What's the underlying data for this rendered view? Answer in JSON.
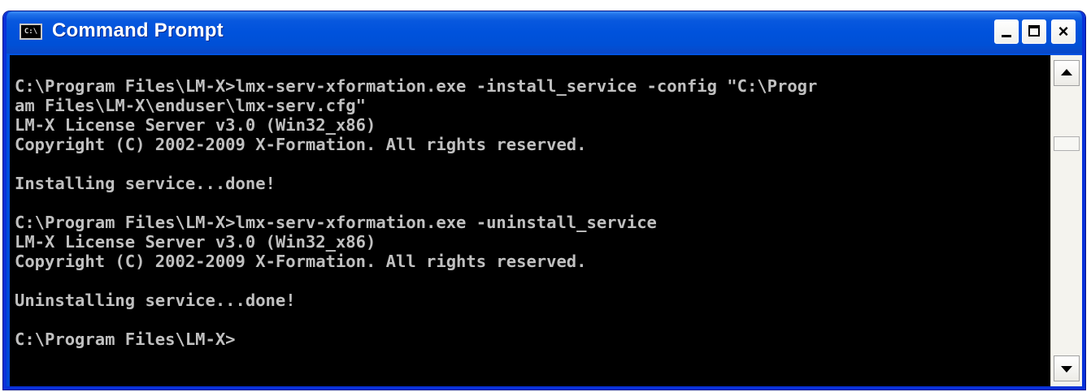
{
  "window": {
    "title": "Command Prompt",
    "icon_label": "C:\\",
    "icon": "console-icon"
  },
  "controls": {
    "minimize": "minimize-icon",
    "maximize": "maximize-icon",
    "close_label": "×"
  },
  "console": {
    "lines": [
      "C:\\Program Files\\LM-X>lmx-serv-xformation.exe -install_service -config \"C:\\Progr",
      "am Files\\LM-X\\enduser\\lmx-serv.cfg\"",
      "LM-X License Server v3.0 (Win32_x86)",
      "Copyright (C) 2002-2009 X-Formation. All rights reserved.",
      "",
      "Installing service...done!",
      "",
      "C:\\Program Files\\LM-X>lmx-serv-xformation.exe -uninstall_service",
      "LM-X License Server v3.0 (Win32_x86)",
      "Copyright (C) 2002-2009 X-Formation. All rights reserved.",
      "",
      "Uninstalling service...done!",
      "",
      "C:\\Program Files\\LM-X>"
    ]
  },
  "scrollbar": {
    "up_icon": "arrow-up-icon",
    "down_icon": "arrow-down-icon",
    "position": 0
  },
  "colors": {
    "titlebar": "#0052dc",
    "console_bg": "#000000",
    "console_fg": "#c0c0c0"
  }
}
